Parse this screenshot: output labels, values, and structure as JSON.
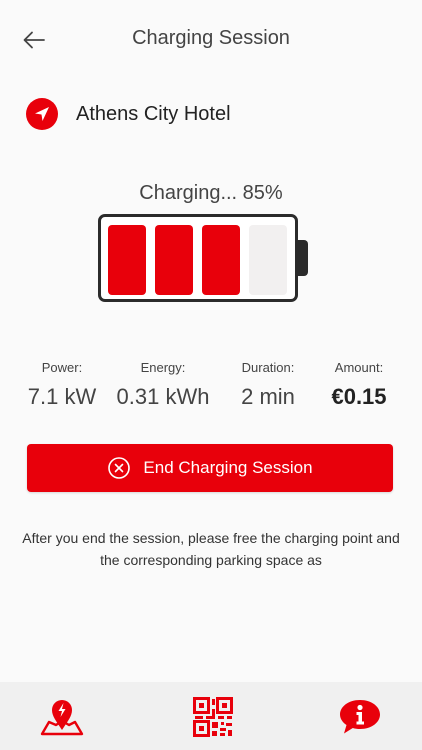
{
  "header": {
    "title": "Charging Session",
    "back_icon": "arrow-left-icon"
  },
  "location": {
    "name": "Athens City Hotel",
    "icon": "navigation-arrow-icon"
  },
  "charging": {
    "status": "Charging... 85%",
    "level_percent": 85,
    "cells_total": 4,
    "cells_filled": 3
  },
  "stats": {
    "power": {
      "label": "Power:",
      "value": "7.1 kW"
    },
    "energy": {
      "label": "Energy:",
      "value": "0.31 kWh"
    },
    "duration": {
      "label": "Duration:",
      "value": "2 min"
    },
    "amount": {
      "label": "Amount:",
      "value": "€0.15"
    }
  },
  "end_button": {
    "label": "End Charging Session",
    "icon": "close-circle-icon"
  },
  "info": {
    "text": "After you end the session, please free the charging point and the corresponding parking space as"
  },
  "bottom_nav": {
    "map_icon": "map-lightning-pin-icon",
    "qr_icon": "qr-code-icon",
    "info_icon": "info-chat-icon"
  },
  "colors": {
    "accent": "#e8000b",
    "battery_outline": "#2b2b2b",
    "empty_cell": "#f2f0f0",
    "bottom_bar": "#f0f0f0"
  }
}
